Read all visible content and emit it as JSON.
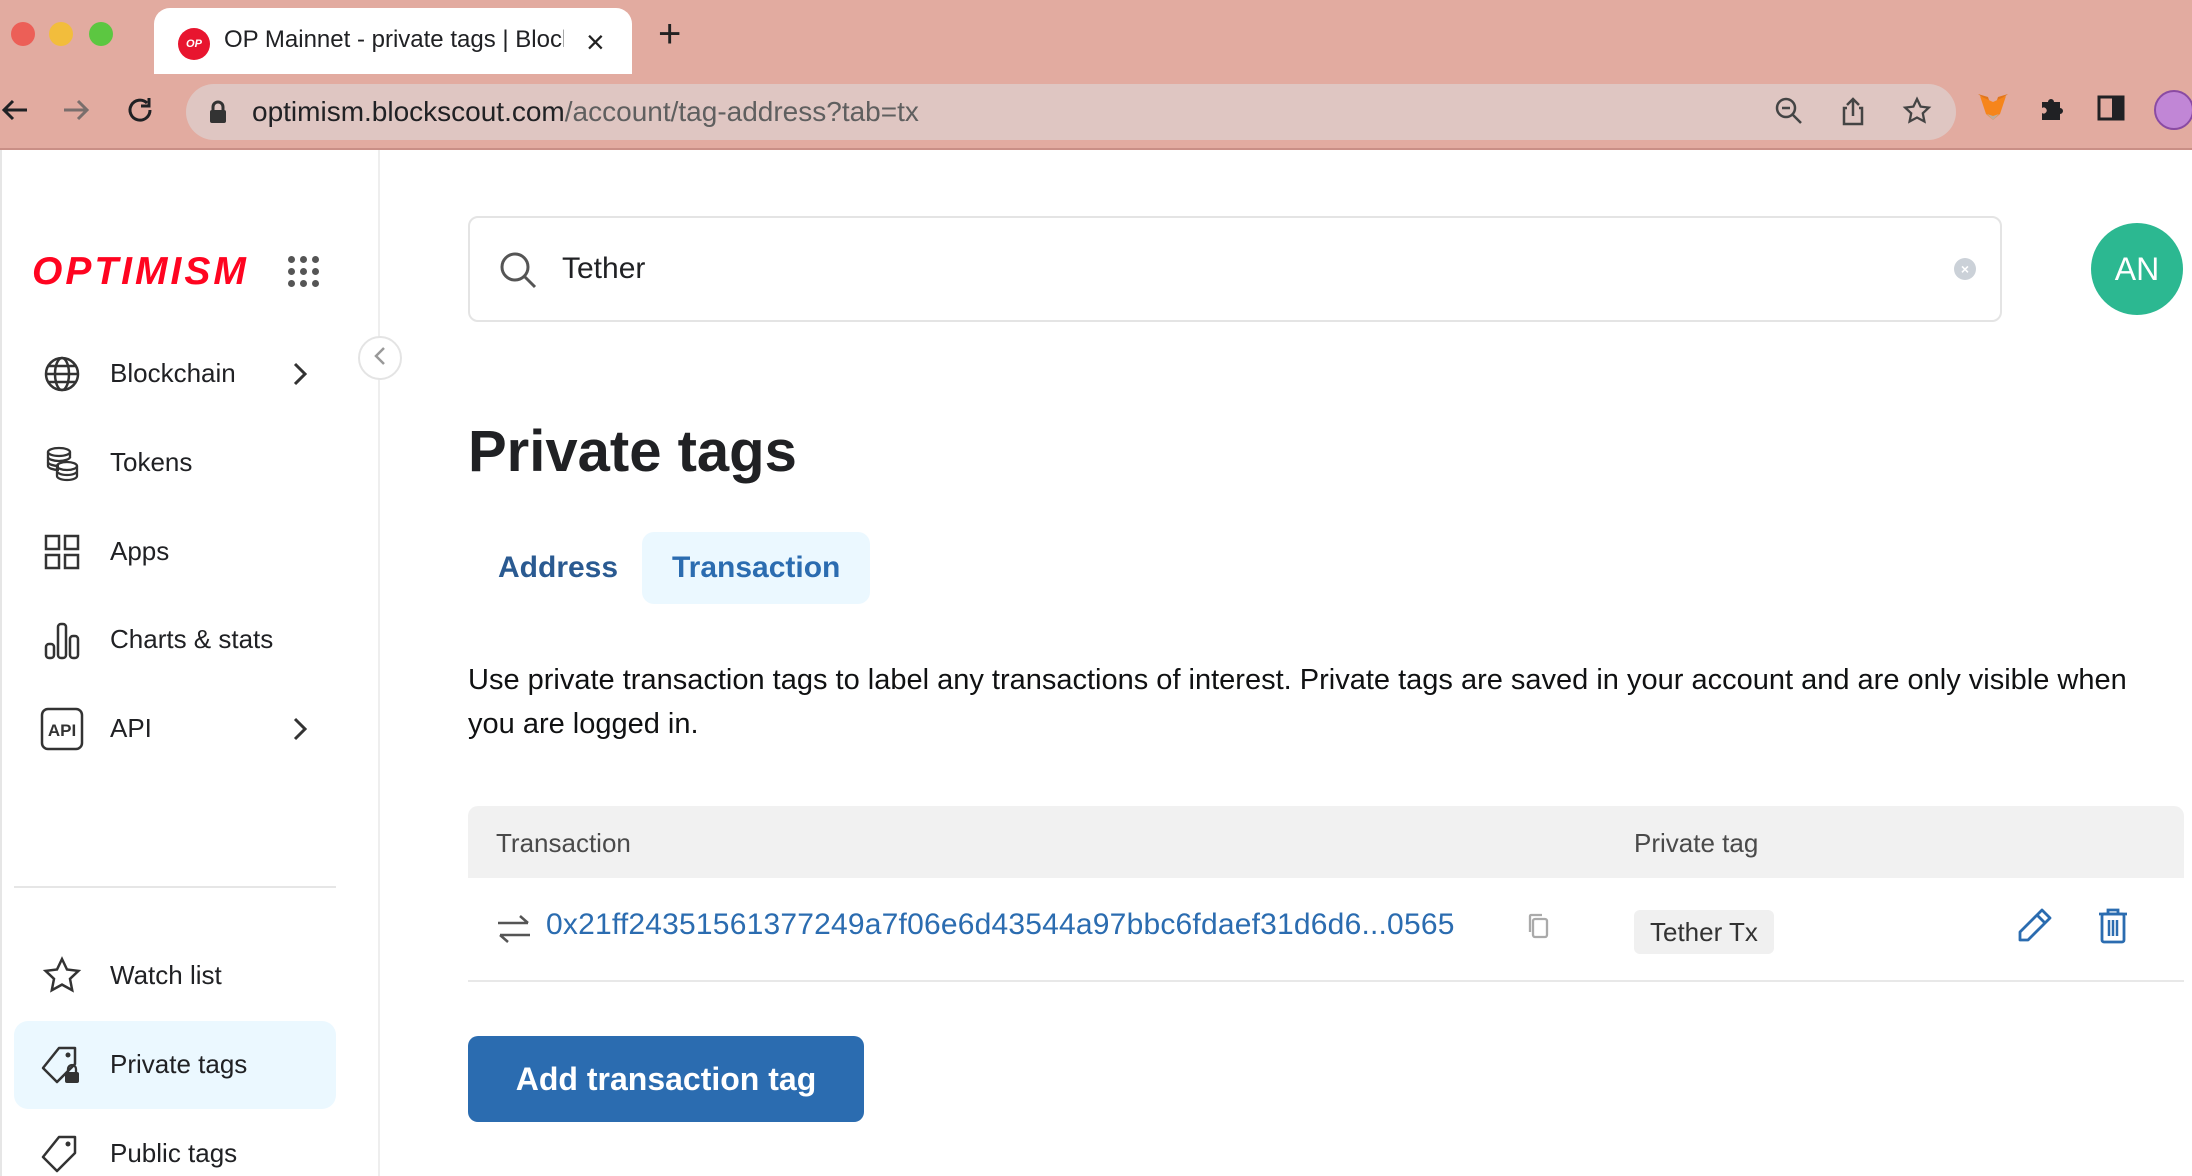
{
  "browser": {
    "tab_title": "OP Mainnet - private tags | Blockscout",
    "favicon_text": "OP",
    "url_domain": "optimism.blockscout.com",
    "url_path": "/account/tag-address?tab=tx"
  },
  "sidebar": {
    "logo": "OPTIMISM",
    "items": [
      {
        "label": "Blockchain",
        "icon": "globe-icon",
        "has_submenu": true
      },
      {
        "label": "Tokens",
        "icon": "coins-icon",
        "has_submenu": false
      },
      {
        "label": "Apps",
        "icon": "apps-icon",
        "has_submenu": false
      },
      {
        "label": "Charts & stats",
        "icon": "chart-icon",
        "has_submenu": false
      },
      {
        "label": "API",
        "icon": "api-icon",
        "has_submenu": true
      }
    ],
    "account_items": [
      {
        "label": "Watch list",
        "icon": "star-icon"
      },
      {
        "label": "Private tags",
        "icon": "tag-lock-icon",
        "active": true
      },
      {
        "label": "Public tags",
        "icon": "tag-icon"
      }
    ],
    "api_icon_text": "API"
  },
  "header": {
    "search_value": "Tether",
    "avatar_initials": "AN"
  },
  "main": {
    "title": "Private tags",
    "tabs": [
      {
        "label": "Address",
        "selected": false
      },
      {
        "label": "Transaction",
        "selected": true
      }
    ],
    "description": "Use private transaction tags to label any transactions of interest. Private tags are saved in your account and are only visible when you are logged in.",
    "table": {
      "columns": [
        "Transaction",
        "Private tag"
      ],
      "rows": [
        {
          "tx_hash": "0x21ff24351561377249a7f06e6d43544a97bbc6fdaef31d6d6...0565",
          "tag": "Tether Tx"
        }
      ]
    },
    "add_button": "Add transaction tag"
  },
  "colors": {
    "brand": "#ff0420",
    "link": "#2b6cb0",
    "button": "#2b6cb0",
    "avatar": "#2cb891",
    "active_bg": "#ebf8ff"
  }
}
